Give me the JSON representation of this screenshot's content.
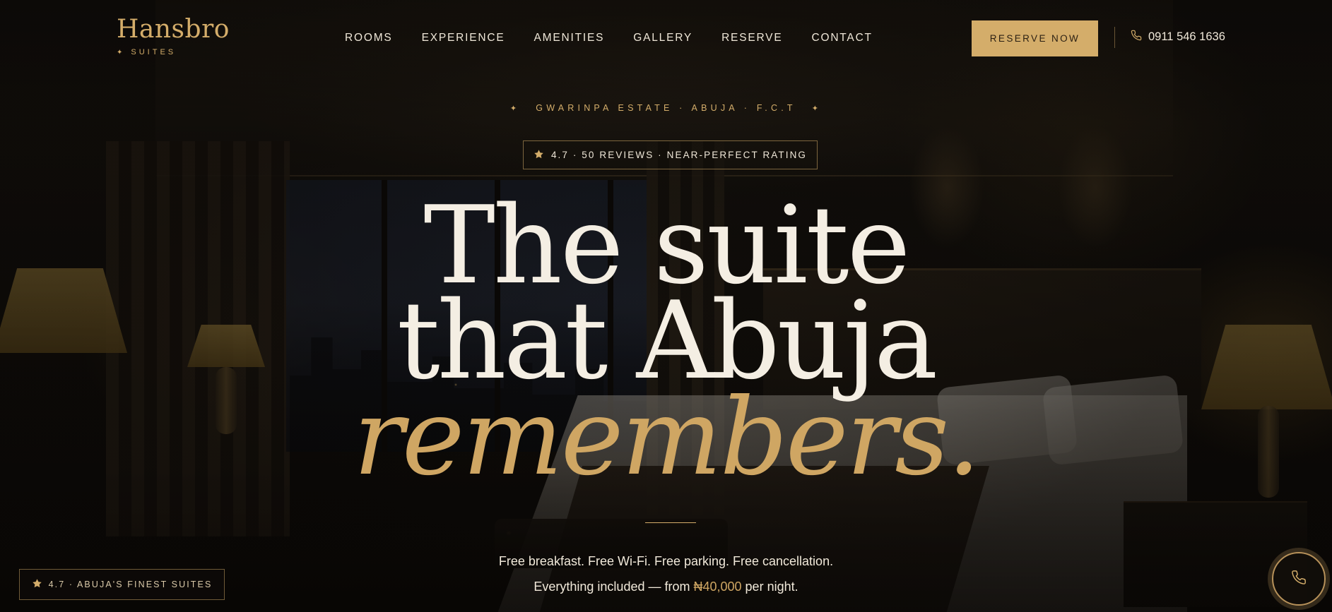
{
  "brand": {
    "name": "Hansbro",
    "sub": "SUITES",
    "sub_star": "✦",
    "color": "#d4ad6a"
  },
  "nav": {
    "items": [
      {
        "label": "ROOMS"
      },
      {
        "label": "EXPERIENCE"
      },
      {
        "label": "AMENITIES"
      },
      {
        "label": "GALLERY"
      },
      {
        "label": "RESERVE"
      },
      {
        "label": "CONTACT"
      }
    ]
  },
  "header": {
    "reserve_label": "RESERVE NOW",
    "phone": "0911 546 1636",
    "phone_icon": "phone-icon"
  },
  "hero": {
    "location": "GWARINPA ESTATE · ABUJA · F.C.T",
    "location_star": "✦",
    "rating_pill": "4.7 · 50 REVIEWS · NEAR-PERFECT RATING",
    "headline_line1": "The suite",
    "headline_line2": "that Abuja",
    "headline_line3": "remembers.",
    "tagline_line1": "Free breakfast. Free Wi-Fi. Free parking. Free cancellation.",
    "tagline_prefix": "Everything included — from ",
    "tagline_price": "₦40,000",
    "tagline_suffix": " per night."
  },
  "badge": {
    "text": "4.7 · ABUJA'S FINEST SUITES",
    "icon": "star-icon"
  },
  "fab": {
    "icon": "phone-icon"
  },
  "colors": {
    "gold": "#d4ad6a",
    "headline": "#f4eee3",
    "accent_italic": "#cfa663",
    "background": "#0d0b09"
  }
}
